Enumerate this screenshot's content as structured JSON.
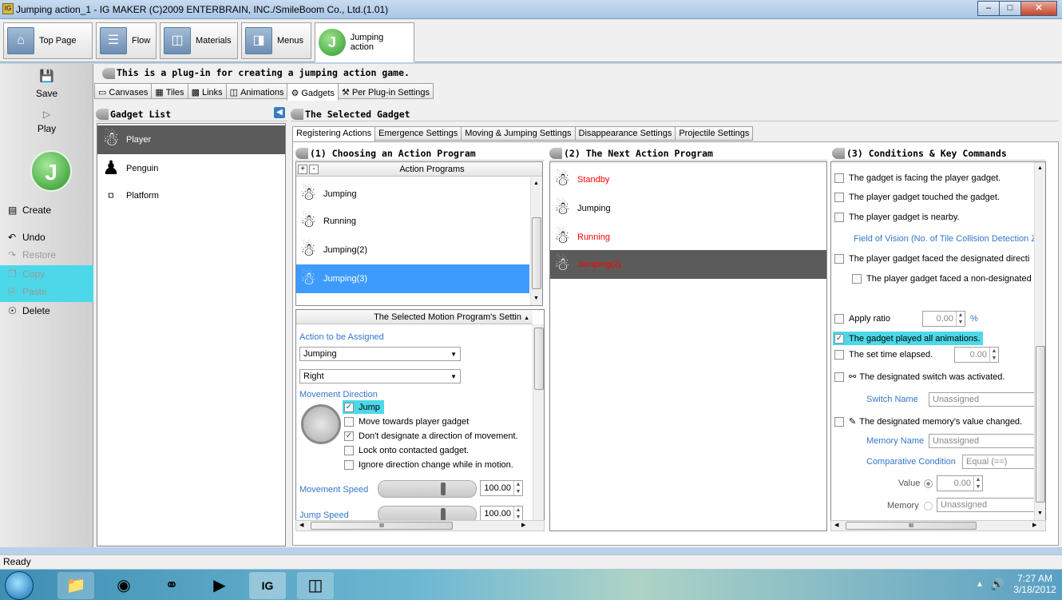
{
  "window": {
    "title": "Jumping action_1 - IG MAKER (C)2009 ENTERBRAIN, INC./SmileBoom Co., Ltd.(1.01)",
    "app_icon": "IG"
  },
  "top_tabs": [
    {
      "label": "Top Page",
      "icon": "home-icon"
    },
    {
      "label": "Flow",
      "icon": "flow-icon"
    },
    {
      "label": "Materials",
      "icon": "materials-icon"
    },
    {
      "label": "Menus",
      "icon": "menus-icon"
    },
    {
      "label": "Jumping action",
      "icon": "jumping-action-icon",
      "selected": true
    }
  ],
  "left_bar": {
    "save": "Save",
    "play": "Play",
    "create": "Create",
    "undo": "Undo",
    "restore": "Restore",
    "copy": "Copy",
    "paste": "Paste",
    "delete": "Delete",
    "logo": "J"
  },
  "banner": "This is a plug-in for creating a jumping action game.",
  "sub_tabs": [
    "Canvases",
    "Tiles",
    "Links",
    "Animations",
    "Gadgets",
    "Per Plug-in Settings"
  ],
  "gadget_list": {
    "header": "Gadget List",
    "items": [
      "Player",
      "Penguin",
      "Platform"
    ]
  },
  "selected_gadget": {
    "header": "The Selected Gadget",
    "tabs": [
      "Registering Actions",
      "Emergence Settings",
      "Moving & Jumping Settings",
      "Disappearance Settings",
      "Projectile Settings"
    ]
  },
  "section1": {
    "header": "(1) Choosing an Action Program",
    "list_header": "Action Programs",
    "add": "+",
    "remove": "-",
    "items": [
      "Jumping",
      "Running",
      "Jumping(2)",
      "Jumping(3)"
    ],
    "settings_header": "The Selected Motion Program's Settin",
    "action_label": "Action to be Assigned",
    "action_value": "Jumping",
    "direction_value": "Right",
    "movement_direction_label": "Movement Direction",
    "checks": [
      {
        "label": "Jump",
        "checked": true
      },
      {
        "label": "Move towards player gadget",
        "checked": false
      },
      {
        "label": "Don't designate a direction of movement.",
        "checked": true
      },
      {
        "label": "Lock onto contacted gadget.",
        "checked": false
      },
      {
        "label": "Ignore direction change while in motion.",
        "checked": false
      }
    ],
    "movement_speed_label": "Movement Speed",
    "movement_speed": "100.00",
    "jump_speed_label": "Jump Speed",
    "jump_speed": "100.00",
    "scroll_label": "III"
  },
  "section2": {
    "header": "(2) The Next Action Program",
    "items": [
      "Standby",
      "Jumping",
      "Running",
      "Jumping(2)"
    ]
  },
  "section3": {
    "header": "(3) Conditions & Key Commands",
    "conds": [
      "The gadget is facing the player gadget.",
      "The player gadget touched the gadget.",
      "The player gadget is nearby.",
      "Field of Vision (No. of Tile Collision Detection Z",
      "The player gadget faced the designated directi",
      "The player gadget faced a non-designated"
    ],
    "apply_ratio": "Apply ratio",
    "ratio_value": "0.00",
    "percent": "%",
    "played_all": "The gadget played all animations.",
    "time_elapsed": "The set time elapsed.",
    "time_value": "0.00",
    "switch_activated": "The designated switch was activated.",
    "switch_name_label": "Switch Name",
    "switch_name_value": "Unassigned",
    "memory_changed": "The designated memory's value changed.",
    "memory_name_label": "Memory Name",
    "memory_name_value": "Unassigned",
    "comparative_label": "Comparative Condition",
    "comparative_value": "Equal (==)",
    "value_label": "Value",
    "value_value": "0.00",
    "memory_label": "Memory",
    "memory_value": "Unassigned",
    "scroll_label": "III"
  },
  "status": "Ready",
  "clock": {
    "time": "7:27 AM",
    "date": "3/18/2012"
  }
}
